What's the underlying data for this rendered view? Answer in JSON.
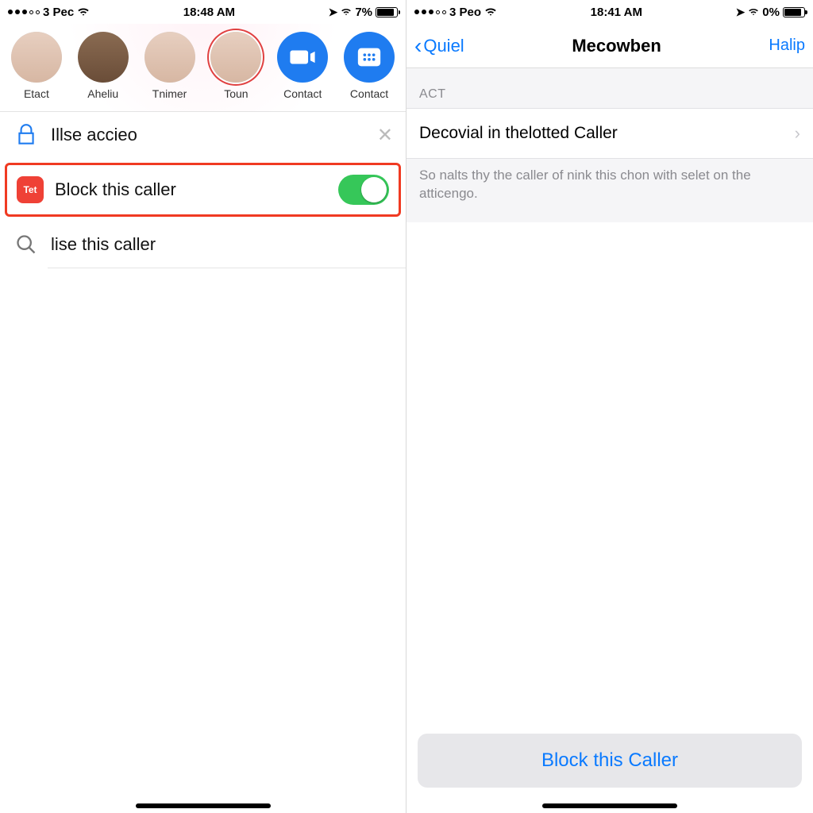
{
  "left": {
    "status": {
      "carrier": "3 Pec",
      "time": "18:48 AM",
      "battery_pct": "7%"
    },
    "favorites": [
      {
        "label": "Etact",
        "kind": "photo"
      },
      {
        "label": "Aheliu",
        "kind": "photo"
      },
      {
        "label": "Tnimer",
        "kind": "photo"
      },
      {
        "label": "Toun",
        "kind": "photo-ring"
      },
      {
        "label": "Contact",
        "kind": "video"
      },
      {
        "label": "Contact",
        "kind": "keypad"
      }
    ],
    "rows": {
      "row1_label": "Illse accieo",
      "block_label": "Block this caller",
      "block_icon_text": "Tet",
      "block_toggle_on": true,
      "row3_label": "lise this caller"
    }
  },
  "right": {
    "status": {
      "carrier": "3 Peo",
      "time": "18:41 AM",
      "battery_pct": "0%"
    },
    "nav": {
      "back": "Quiel",
      "title": "Mecowben",
      "action": "Halip"
    },
    "section_header": "ACT",
    "row_label": "Decovial in thelotted Caller",
    "footer_note": "So nalts thy the caller of nink this chon with selet on the atticengo.",
    "action_button": "Block this Caller"
  }
}
